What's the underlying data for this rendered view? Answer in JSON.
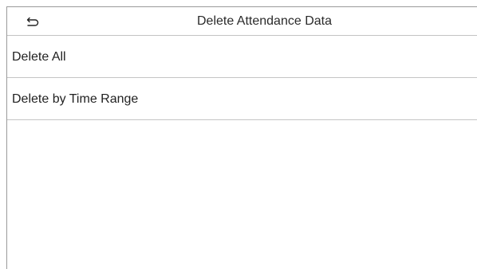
{
  "header": {
    "title": "Delete Attendance Data",
    "back_icon": "back-arrow-icon"
  },
  "menu": {
    "items": [
      {
        "label": "Delete All"
      },
      {
        "label": "Delete by Time Range"
      }
    ]
  }
}
